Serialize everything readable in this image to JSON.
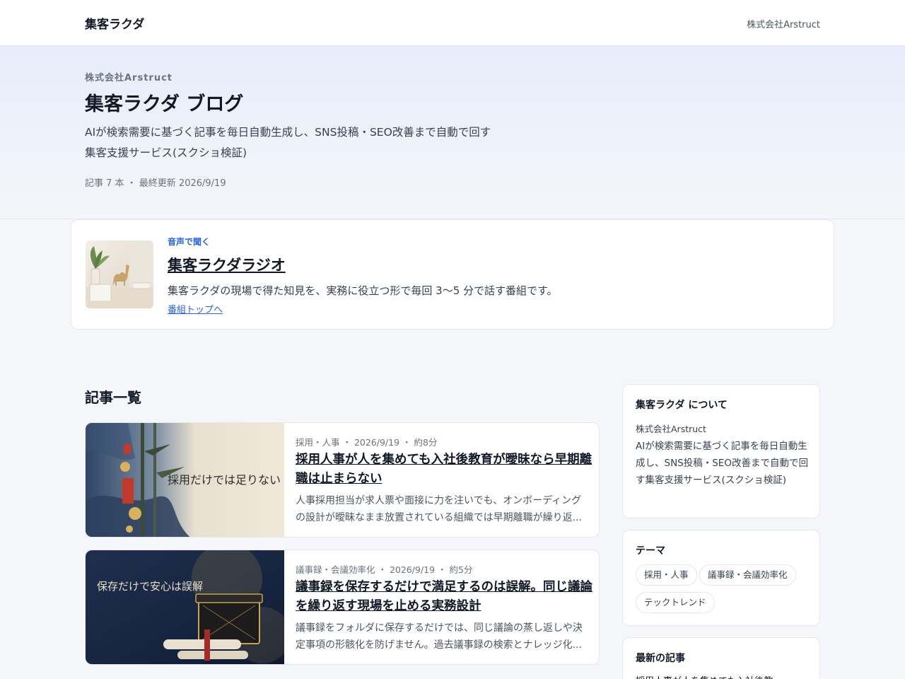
{
  "header": {
    "brand": "集客ラクダ",
    "company_link": "株式会社Arstruct"
  },
  "hero": {
    "company": "株式会社Arstruct",
    "title": "集客ラクダ ブログ",
    "description": "AIが検索需要に基づく記事を毎日自動生成し、SNS投稿・SEO改善まで自動で回す集客支援サービス(スクショ検証)",
    "meta": "記事 7 本 ・ 最終更新 2026/9/19"
  },
  "radio": {
    "eyebrow": "音声で聞く",
    "title": "集客ラクダラジオ",
    "description": "集客ラクダの現場で得た知見を、実務に役立つ形で毎回 3〜5 分で話す番組です。",
    "link": "番組トップへ"
  },
  "articles_section": {
    "heading": "記事一覧",
    "items": [
      {
        "meta": "採用・人事 ・ 2026/9/19 ・ 約8分",
        "title": "採用人事が人を集めても入社後教育が曖昧なら早期離職は止まらない",
        "excerpt": "人事採用担当が求人票や面接に力を注いでも、オンボーディングの設計が曖昧なまま放置されている組織では早期離職が繰り返...",
        "thumb_text": "採用だけでは足りない"
      },
      {
        "meta": "議事録・会議効率化 ・ 2026/9/19 ・ 約5分",
        "title": "議事録を保存するだけで満足するのは誤解。同じ議論を繰り返す現場を止める実務設計",
        "excerpt": "議事録をフォルダに保存するだけでは、同じ議論の蒸し返しや決定事項の形骸化を防げません。過去議事録の検索とナレッジ化...",
        "thumb_text": "保存だけで安心は誤解"
      }
    ]
  },
  "sidebar": {
    "about": {
      "title": "集客ラクダ について",
      "company": "株式会社Arstruct",
      "description": "AIが検索需要に基づく記事を毎日自動生成し、SNS投稿・SEO改善まで自動で回す集客支援サービス(スクショ検証)"
    },
    "themes": {
      "title": "テーマ",
      "tags": [
        "採用・人事",
        "議事録・会議効率化",
        "テックトレンド"
      ]
    },
    "recent": {
      "title": "最新の記事",
      "items": [
        "採用人事が人を集めても入社後教"
      ]
    }
  }
}
